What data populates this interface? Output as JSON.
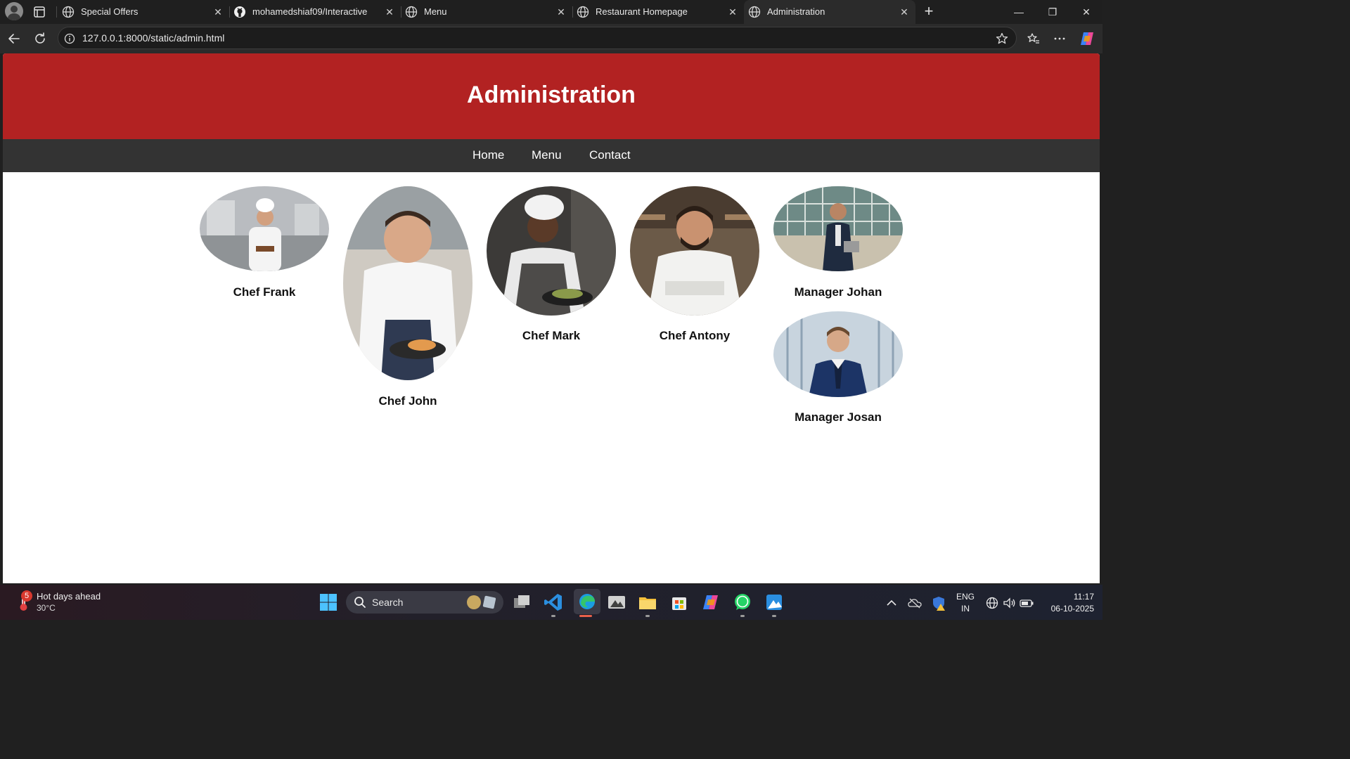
{
  "browser": {
    "tabs": [
      {
        "title": "Special Offers",
        "favicon": "globe-icon",
        "active": false
      },
      {
        "title": "mohamedshiaf09/Interactive",
        "favicon": "github-icon",
        "active": false
      },
      {
        "title": "Menu",
        "favicon": "globe-icon",
        "active": false
      },
      {
        "title": "Restaurant Homepage",
        "favicon": "globe-icon",
        "active": false
      },
      {
        "title": "Administration",
        "favicon": "globe-icon",
        "active": true
      }
    ],
    "url": "127.0.0.1:8000/static/admin.html"
  },
  "page": {
    "header_title": "Administration",
    "nav": [
      "Home",
      "Menu",
      "Contact"
    ],
    "staff": [
      {
        "name": "Chef Frank"
      },
      {
        "name": "Chef John"
      },
      {
        "name": "Chef Mark"
      },
      {
        "name": "Chef Antony"
      },
      {
        "name": "Manager Johan"
      },
      {
        "name": "Manager Josan"
      }
    ],
    "colors": {
      "header": "#b22222",
      "nav": "#333333"
    }
  },
  "taskbar": {
    "weather_title": "Hot days ahead",
    "weather_temp": "30°C",
    "weather_badge": "5",
    "search_placeholder": "Search",
    "lang_top": "ENG",
    "lang_bottom": "IN",
    "time": "11:17",
    "date": "06-10-2025"
  }
}
